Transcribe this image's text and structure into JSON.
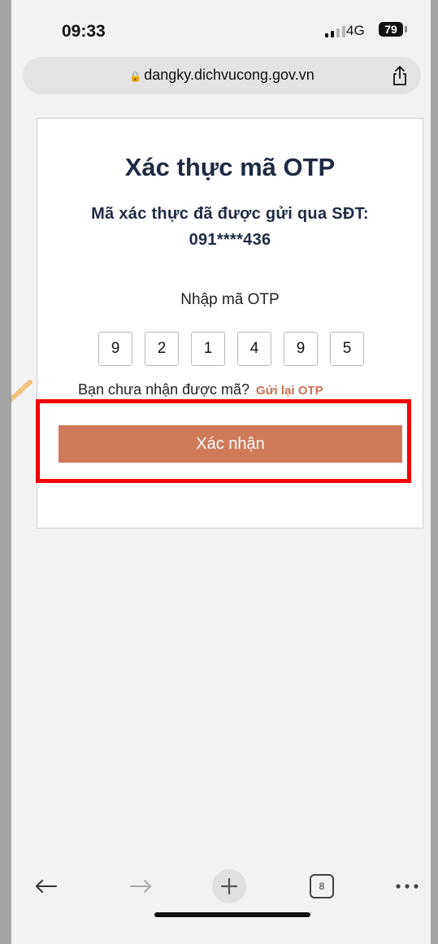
{
  "status_bar": {
    "time": "09:33",
    "network": "4G",
    "battery": "79"
  },
  "browser": {
    "url": "dangky.dichvucong.gov.vn",
    "tabs_count": "8"
  },
  "otp_page": {
    "title": "Xác thực mã OTP",
    "subtitle_line1": "Mã xác thực đã được gửi qua SĐT:",
    "subtitle_line2": "091****436",
    "otp_label": "Nhập mã OTP",
    "otp_digits": [
      "9",
      "2",
      "1",
      "4",
      "9",
      "5"
    ],
    "resend_prompt": "Bạn chưa nhận được mã?",
    "resend_link": "Gửi lại OTP",
    "confirm_label": "Xác nhận"
  },
  "colors": {
    "accent": "#cf7a5a",
    "highlight": "#f00000",
    "title": "#1f2a44"
  },
  "icons": [
    "lock-icon",
    "share-icon",
    "back-arrow-icon",
    "forward-arrow-icon",
    "new-tab-icon",
    "tabs-icon",
    "more-icon"
  ]
}
